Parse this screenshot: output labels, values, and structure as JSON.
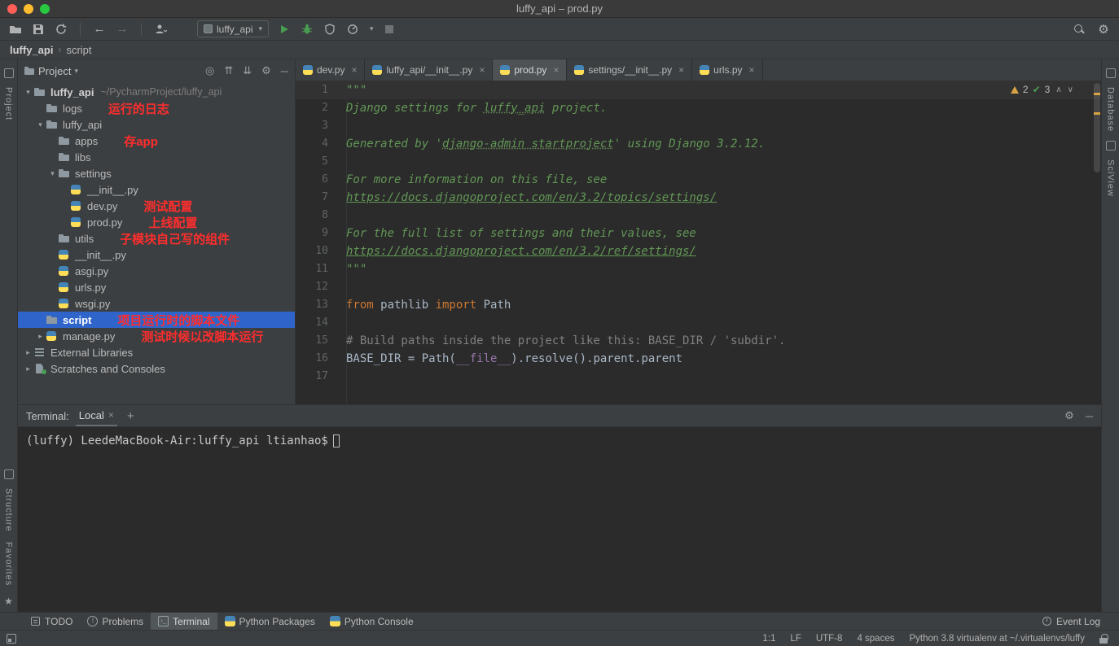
{
  "window": {
    "title": "luffy_api – prod.py"
  },
  "toolbar": {
    "run_config": "luffy_api"
  },
  "breadcrumbs": {
    "items": [
      "luffy_api",
      "script"
    ]
  },
  "rails": {
    "left_top": "Project",
    "left_bottom": [
      "Structure",
      "Favorites"
    ],
    "right": [
      "Database",
      "SciView"
    ]
  },
  "project": {
    "header": "Project",
    "tree": [
      {
        "level": 0,
        "chev": "down",
        "icon": "folder",
        "label": "luffy_api",
        "hint": "~/PycharmProject/luffy_api",
        "root": true
      },
      {
        "level": 1,
        "chev": "none",
        "icon": "folder",
        "label": "logs",
        "note": "运行的日志"
      },
      {
        "level": 1,
        "chev": "down",
        "icon": "folder",
        "label": "luffy_api"
      },
      {
        "level": 2,
        "chev": "none",
        "icon": "folder",
        "label": "apps",
        "note": "存app"
      },
      {
        "level": 2,
        "chev": "none",
        "icon": "folder",
        "label": "libs"
      },
      {
        "level": 2,
        "chev": "down",
        "icon": "folder",
        "label": "settings"
      },
      {
        "level": 3,
        "chev": "none",
        "icon": "python",
        "label": "__init__.py"
      },
      {
        "level": 3,
        "chev": "none",
        "icon": "python",
        "label": "dev.py",
        "note": "测试配置"
      },
      {
        "level": 3,
        "chev": "none",
        "icon": "python",
        "label": "prod.py",
        "note": "上线配置"
      },
      {
        "level": 2,
        "chev": "none",
        "icon": "folder",
        "label": "utils",
        "note": "子模块自己写的组件"
      },
      {
        "level": 2,
        "chev": "none",
        "icon": "python",
        "label": "__init__.py"
      },
      {
        "level": 2,
        "chev": "none",
        "icon": "python",
        "label": "asgi.py"
      },
      {
        "level": 2,
        "chev": "none",
        "icon": "python",
        "label": "urls.py"
      },
      {
        "level": 2,
        "chev": "none",
        "icon": "python",
        "label": "wsgi.py"
      },
      {
        "level": 1,
        "chev": "none",
        "icon": "folder",
        "label": "script",
        "selected": true,
        "note": "项目运行时的脚本文件"
      },
      {
        "level": 1,
        "chev": "right",
        "icon": "python",
        "label": "manage.py",
        "note": "测试时候以改脚本运行"
      },
      {
        "level": 0,
        "chev": "right",
        "icon": "libs",
        "label": "External Libraries"
      },
      {
        "level": 0,
        "chev": "right",
        "icon": "scratch",
        "label": "Scratches and Consoles"
      }
    ]
  },
  "editor": {
    "tabs": [
      {
        "label": "dev.py"
      },
      {
        "label": "luffy_api/__init__.py"
      },
      {
        "label": "prod.py",
        "active": true
      },
      {
        "label": "settings/__init__.py"
      },
      {
        "label": "urls.py"
      }
    ],
    "inspections": {
      "warnings": "2",
      "passed": "3"
    },
    "caret_line": 1,
    "lines": [
      {
        "s": [
          [
            "doc",
            "\"\"\""
          ]
        ]
      },
      {
        "s": [
          [
            "doc",
            "Django settings for "
          ],
          [
            "typo",
            "luffy_api"
          ],
          [
            "doc",
            " project."
          ]
        ]
      },
      {
        "s": []
      },
      {
        "s": [
          [
            "doc",
            "Generated by '"
          ],
          [
            "typo",
            "django-admin startproject"
          ],
          [
            "doc",
            "' using Django 3.2.12."
          ]
        ]
      },
      {
        "s": []
      },
      {
        "s": [
          [
            "doc",
            "For more information on this file, see"
          ]
        ]
      },
      {
        "s": [
          [
            "doclink",
            "https://docs.djangoproject.com/en/3.2/topics/settings/"
          ]
        ]
      },
      {
        "s": []
      },
      {
        "s": [
          [
            "doc",
            "For the full list of settings and their values, see"
          ]
        ]
      },
      {
        "s": [
          [
            "doclink",
            "https://docs.djangoproject.com/en/3.2/ref/settings/"
          ]
        ]
      },
      {
        "s": [
          [
            "doc",
            "\"\"\""
          ]
        ]
      },
      {
        "s": []
      },
      {
        "s": [
          [
            "kw",
            "from"
          ],
          [
            "plain",
            " pathlib "
          ],
          [
            "kw",
            "import"
          ],
          [
            "plain",
            " Path"
          ]
        ]
      },
      {
        "s": []
      },
      {
        "s": [
          [
            "comment",
            "# Build paths inside the project like this: BASE_DIR / 'subdir'."
          ]
        ]
      },
      {
        "s": [
          [
            "plain",
            "BASE_DIR = Path("
          ],
          [
            "dunder",
            "__file__"
          ],
          [
            "plain",
            ").resolve().parent.parent"
          ]
        ]
      },
      {
        "s": []
      }
    ]
  },
  "terminal": {
    "label": "Terminal:",
    "tab": "Local",
    "prompt": "(luffy) LeedeMacBook-Air:luffy_api ltianhao$"
  },
  "toolwindows": {
    "tabs": [
      {
        "label": "TODO",
        "icon": "todo"
      },
      {
        "label": "Problems",
        "icon": "problems"
      },
      {
        "label": "Terminal",
        "icon": "terminal",
        "active": true
      },
      {
        "label": "Python Packages",
        "icon": "python"
      },
      {
        "label": "Python Console",
        "icon": "python"
      }
    ],
    "event_log": "Event Log"
  },
  "status": {
    "position": "1:1",
    "line_sep": "LF",
    "encoding": "UTF-8",
    "indent": "4 spaces",
    "interpreter": "Python 3.8 virtualenv at ~/.virtualenvs/luffy"
  }
}
